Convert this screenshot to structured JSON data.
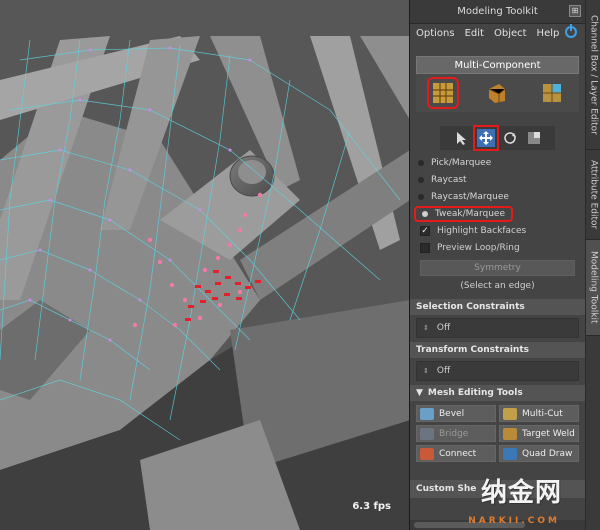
{
  "viewport": {
    "fps": "6.3 fps"
  },
  "toolkit": {
    "title": "Modeling Toolkit",
    "menu": [
      "Options",
      "Edit",
      "Object",
      "Help"
    ],
    "multi_component": "Multi-Component",
    "select_modes": [
      "Pick/Marquee",
      "Raycast",
      "Raycast/Marquee",
      "Tweak/Marquee"
    ],
    "highlight_backfaces": "Highlight Backfaces",
    "preview_loop": "Preview Loop/Ring",
    "symmetry": "Symmetry",
    "select_hint": "(Select an edge)",
    "selection_constraints": {
      "title": "Selection Constraints",
      "value": "Off"
    },
    "transform_constraints": {
      "title": "Transform Constraints",
      "value": "Off"
    },
    "mesh_editing_tools": {
      "title": "Mesh Editing Tools",
      "buttons": [
        "Bevel",
        "Multi-Cut",
        "Bridge",
        "Target Weld",
        "Connect",
        "Quad Draw"
      ]
    },
    "custom_shelf": "Custom She"
  },
  "side_tabs": [
    "Channel Box / Layer Editor",
    "Attribute Editor",
    "Modeling Toolkit"
  ],
  "watermark": {
    "text": "纳金网",
    "sub": "NARKII.COM"
  },
  "colors": {
    "highlight": "#e41b1b",
    "accent": "#3da0e8",
    "wire": "#5ad6e6"
  }
}
